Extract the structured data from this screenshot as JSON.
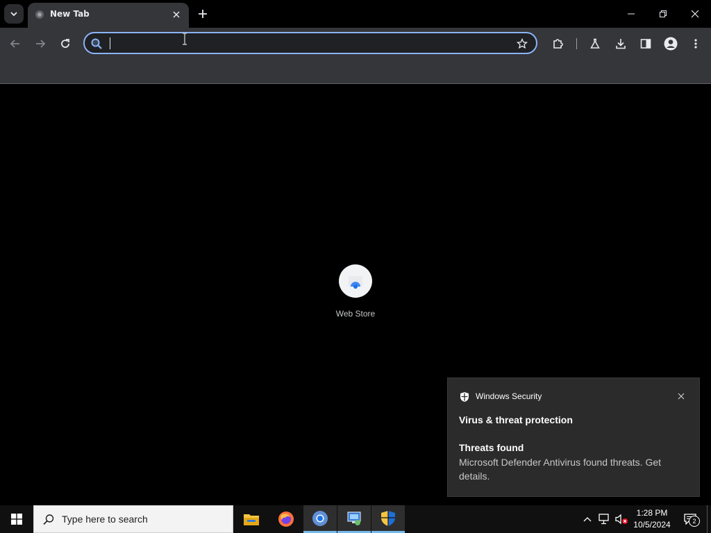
{
  "browser": {
    "tab": {
      "title": "New Tab"
    },
    "omnibox": {
      "value": "",
      "placeholder": ""
    },
    "shortcuts": [
      {
        "label": "Web Store"
      }
    ],
    "accent_color": "#8ab4f8"
  },
  "toast": {
    "app_name": "Windows Security",
    "heading": "Virus & threat protection",
    "title": "Threats found",
    "body": "Microsoft Defender Antivirus found threats. Get details."
  },
  "taskbar": {
    "search_placeholder": "Type here to search",
    "apps": [
      {
        "icon": "file-explorer-icon",
        "active": false
      },
      {
        "icon": "firefox-icon",
        "active": false
      },
      {
        "icon": "chrome-icon",
        "active": true
      },
      {
        "icon": "control-panel-icon",
        "active": true
      },
      {
        "icon": "windows-security-icon",
        "active": true
      }
    ],
    "clock": {
      "time": "1:28 PM",
      "date": "10/5/2024"
    },
    "notification_count": "2"
  }
}
